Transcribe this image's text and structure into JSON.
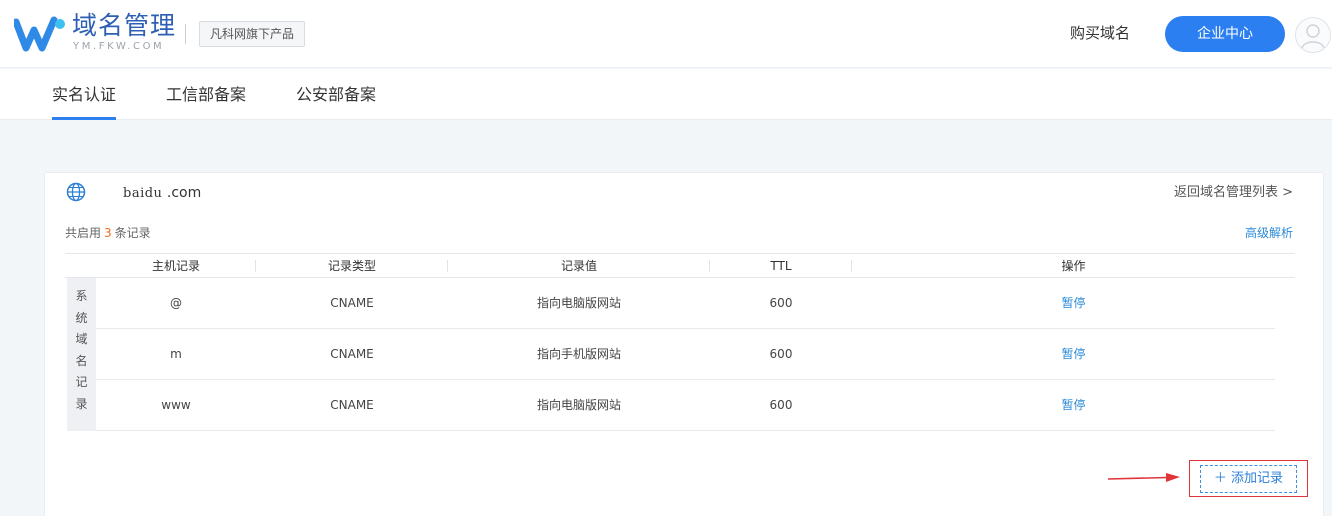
{
  "header": {
    "title": "域名管理",
    "subtitle": "YM.FKW.COM",
    "brand_tag": "凡科网旗下产品",
    "buy_link": "购买域名",
    "corp_button": "企业中心"
  },
  "tabs": [
    {
      "label": "实名认证",
      "active": true
    },
    {
      "label": "工信部备案",
      "active": false
    },
    {
      "label": "公安部备案",
      "active": false
    }
  ],
  "card": {
    "domain_prefix": "baidu",
    "domain_suffix": " .com",
    "back_link": "返回域名管理列表 >",
    "count_prefix": "共启用",
    "count_value": "3",
    "count_suffix": "条记录",
    "advanced_link": "高级解析"
  },
  "table": {
    "headers": [
      "主机记录",
      "记录类型",
      "记录值",
      "TTL",
      "操作"
    ],
    "side_label": [
      "系",
      "统",
      "域",
      "名",
      "记",
      "录"
    ],
    "rows": [
      {
        "host": "@",
        "type": "CNAME",
        "value": "指向电脑版网站",
        "ttl": "600",
        "action": "暂停"
      },
      {
        "host": "m",
        "type": "CNAME",
        "value": "指向手机版网站",
        "ttl": "600",
        "action": "暂停"
      },
      {
        "host": "www",
        "type": "CNAME",
        "value": "指向电脑版网站",
        "ttl": "600",
        "action": "暂停"
      }
    ]
  },
  "add_button": "＋ 添加记录",
  "colors": {
    "accent": "#2b7ff1",
    "link": "#2b8ad8",
    "count_highlight": "#f26b1d",
    "annotation_red": "#e0333a"
  }
}
